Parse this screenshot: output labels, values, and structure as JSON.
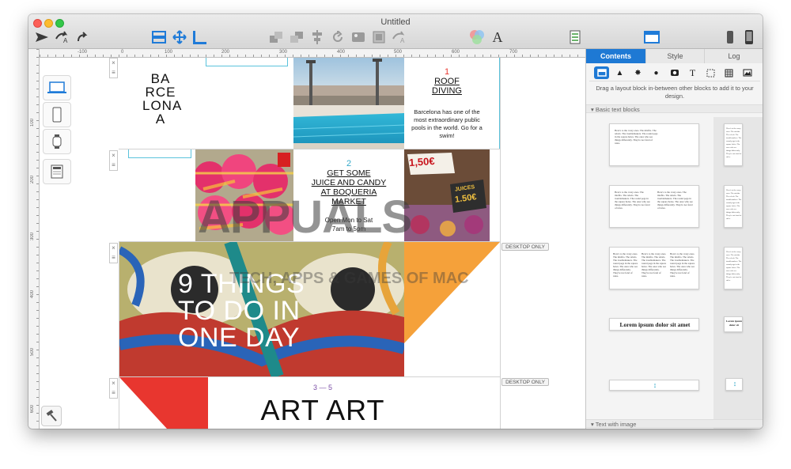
{
  "window": {
    "title": "Untitled"
  },
  "toolbar": {
    "icons": [
      "send-icon",
      "format-painter-icon",
      "redo-icon",
      "layout-icon",
      "move-icon",
      "ruler-icon",
      "bring-front-icon",
      "send-back-icon",
      "align-icon",
      "rotate-icon",
      "image-icon",
      "crop-icon",
      "style-icon",
      "colors-icon",
      "font-icon",
      "checklist-icon",
      "sidebar-icon",
      "iphone-icon",
      "phone-icon"
    ],
    "font_glyph": "A"
  },
  "ruler": {
    "top_labels": [
      "-100",
      "0",
      "100",
      "200",
      "300",
      "400",
      "500",
      "600",
      "700"
    ],
    "left_labels": [
      "100",
      "200",
      "300",
      "400",
      "500",
      "600"
    ]
  },
  "canvas": {
    "block1": {
      "title_lines": [
        "BA",
        "RCE",
        "LONA",
        "A"
      ],
      "item_number": "1",
      "item_title_lines": [
        "ROOF",
        "DIVING"
      ],
      "item_body": "Barcelona has one of the most extraordinary public pools in the world. Go for a swim!"
    },
    "block2": {
      "item_number": "2",
      "item_title_lines": [
        "GET SOME",
        "JUICE AND CANDY",
        "AT BOQUERIA",
        "MARKET"
      ],
      "item_body_lines": [
        "Open Mon to Sat",
        "7am to 5pm"
      ],
      "price_labels": [
        "1,50€",
        "JUICES",
        "1.50€"
      ]
    },
    "block3": {
      "headline_lines": [
        "9 THINGS",
        "TO DO IN",
        "ONE DAY"
      ],
      "badge": "DESKTOP ONLY"
    },
    "block4": {
      "range": "3 — 5",
      "headline": "ART ART",
      "badge": "DESKTOP ONLY"
    },
    "watermark": {
      "brand": "APPUALS",
      "tagline": "TECH, APPS & GAMES OF MAC"
    }
  },
  "sidebar": {
    "tabs": [
      {
        "label": "Contents",
        "active": true
      },
      {
        "label": "Style",
        "active": false
      },
      {
        "label": "Log",
        "active": false
      }
    ],
    "content_types": [
      "layout-icon",
      "triangle-icon",
      "burst-icon",
      "pin-icon",
      "camera-icon",
      "text-icon",
      "dotted-frame-icon",
      "pattern-icon",
      "picture-icon"
    ],
    "hint": "Drag a layout block in-between other blocks to add it to your design.",
    "sections": [
      {
        "label": "Basic text blocks"
      },
      {
        "label": "Text with image"
      }
    ],
    "sample_text": "Here's to the crazy ones. The misfits. The rebels. The troublemakers. The round pegs in the square holes. The ones who see things differently. They're not fond of rules.",
    "lorem": "Lorem ipsum dolor sit amet",
    "lorem_short": "Lorem ipsum dolor sit"
  },
  "colors": {
    "accent": "#1e79d4",
    "red": "#e8362f",
    "cyan": "#33a8c9",
    "orange": "#f5a13a",
    "purple": "#7b4ea6"
  }
}
